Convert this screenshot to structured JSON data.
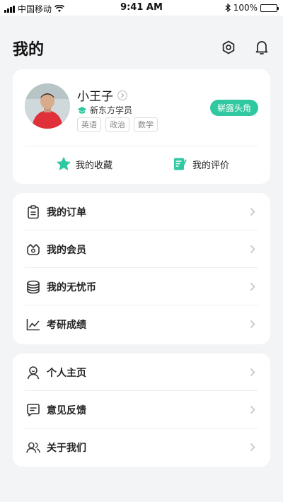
{
  "status_bar": {
    "carrier": "中国移动",
    "time": "9:41 AM",
    "battery": "100%"
  },
  "header": {
    "title": "我的"
  },
  "profile": {
    "name": "小王子",
    "member_label": "新东方学员",
    "tags": [
      "英语",
      "政治",
      "数学"
    ],
    "badge": "崭露头角",
    "quick_links": [
      {
        "label": "我的收藏",
        "icon": "star-icon"
      },
      {
        "label": "我的评价",
        "icon": "review-icon"
      }
    ]
  },
  "menu_group_1": [
    {
      "label": "我的订单",
      "icon": "order-icon"
    },
    {
      "label": "我的会员",
      "icon": "member-icon"
    },
    {
      "label": "我的无忧币",
      "icon": "coin-icon"
    },
    {
      "label": "考研成绩",
      "icon": "chart-icon"
    }
  ],
  "menu_group_2": [
    {
      "label": "个人主页",
      "icon": "user-icon"
    },
    {
      "label": "意见反馈",
      "icon": "feedback-icon"
    },
    {
      "label": "关于我们",
      "icon": "team-icon"
    }
  ],
  "colors": {
    "accent": "#2fc8a0",
    "background": "#f3f4f6"
  }
}
